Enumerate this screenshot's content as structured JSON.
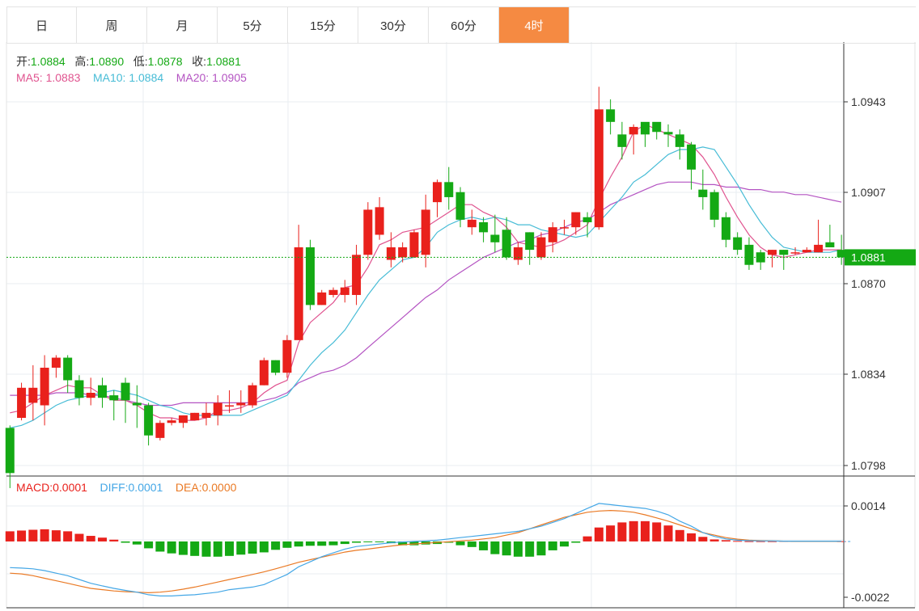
{
  "tabs": [
    {
      "label": "日",
      "active": false
    },
    {
      "label": "周",
      "active": false
    },
    {
      "label": "月",
      "active": false
    },
    {
      "label": "5分",
      "active": false
    },
    {
      "label": "15分",
      "active": false
    },
    {
      "label": "30分",
      "active": false
    },
    {
      "label": "60分",
      "active": false
    },
    {
      "label": "4时",
      "active": true
    }
  ],
  "colors": {
    "accent": "#f58a42",
    "up": "#e9211c",
    "down": "#14a914",
    "ma5": "#e0538f",
    "ma10": "#47bcd6",
    "ma20": "#b453c2",
    "diff": "#44a7e6",
    "dea": "#ea7a25",
    "legend_value": "#14a914",
    "grid": "#e8eef2"
  },
  "ohlc_legend": {
    "open_label": "开:",
    "open_value": "1.0884",
    "high_label": "高:",
    "high_value": "1.0890",
    "low_label": "低:",
    "low_value": "1.0878",
    "close_label": "收:",
    "close_value": "1.0881"
  },
  "ma_legend": {
    "ma5_label": "MA5:",
    "ma5_value": "1.0883",
    "ma10_label": "MA10:",
    "ma10_value": "1.0884",
    "ma20_label": "MA20:",
    "ma20_value": "1.0905"
  },
  "macd_legend": {
    "macd_label": "MACD:",
    "macd_value": "0.0001",
    "diff_label": "DIFF:",
    "diff_value": "0.0001",
    "dea_label": "DEA:",
    "dea_value": "0.0000"
  },
  "chart_data": [
    {
      "type": "candlestick",
      "yticks": [
        "1.0943",
        "1.0907",
        "1.0870",
        "1.0834",
        "1.0798"
      ],
      "ylim": [
        1.0791,
        1.0969
      ],
      "current_price": "1.0881",
      "candles": [
        [
          1.0813,
          1.0795,
          1.0814,
          1.0789
        ],
        [
          1.0817,
          1.0829,
          1.0831,
          1.0816
        ],
        [
          1.0823,
          1.0829,
          1.0838,
          1.0816
        ],
        [
          1.0822,
          1.0837,
          1.0842,
          1.0814
        ],
        [
          1.0837,
          1.0841,
          1.0842,
          1.0833
        ],
        [
          1.0841,
          1.0832,
          1.0842,
          1.0827
        ],
        [
          1.0832,
          1.0825,
          1.0834,
          1.0822
        ],
        [
          1.0825,
          1.0827,
          1.0833,
          1.0822
        ],
        [
          1.083,
          1.0825,
          1.0833,
          1.0821
        ],
        [
          1.0826,
          1.0824,
          1.0828,
          1.0816
        ],
        [
          1.0831,
          1.0824,
          1.0833,
          1.0815
        ],
        [
          1.0823,
          1.0822,
          1.083,
          1.0813
        ],
        [
          1.0822,
          1.081,
          1.0823,
          1.0806
        ],
        [
          1.0809,
          1.0815,
          1.0816,
          1.0808
        ],
        [
          1.0815,
          1.0816,
          1.0817,
          1.0814
        ],
        [
          1.0815,
          1.0818,
          1.0818,
          1.0813
        ],
        [
          1.0816,
          1.0819,
          1.0819,
          1.0816
        ],
        [
          1.0817,
          1.0819,
          1.0823,
          1.0814
        ],
        [
          1.0818,
          1.0823,
          1.0826,
          1.0814
        ],
        [
          1.0822,
          1.0822,
          1.0828,
          1.0819
        ],
        [
          1.0822,
          1.0823,
          1.0828,
          1.0819
        ],
        [
          1.0822,
          1.083,
          1.0831,
          1.0821
        ],
        [
          1.083,
          1.084,
          1.0841,
          1.083
        ],
        [
          1.084,
          1.0835,
          1.084,
          1.0834
        ],
        [
          1.0835,
          1.0848,
          1.085,
          1.0833
        ],
        [
          1.0848,
          1.0885,
          1.0894,
          1.0848
        ],
        [
          1.0885,
          1.0862,
          1.0888,
          1.086
        ],
        [
          1.0862,
          1.0867,
          1.0868,
          1.0862
        ],
        [
          1.0866,
          1.0868,
          1.0869,
          1.0865
        ],
        [
          1.0866,
          1.0869,
          1.0872,
          1.0863
        ],
        [
          1.0866,
          1.0882,
          1.0886,
          1.0862
        ],
        [
          1.0882,
          1.09,
          1.0903,
          1.088
        ],
        [
          1.089,
          1.0901,
          1.0905,
          1.0888
        ],
        [
          1.088,
          1.0885,
          1.0891,
          1.0877
        ],
        [
          1.0881,
          1.0885,
          1.0887,
          1.0879
        ],
        [
          1.0881,
          1.0891,
          1.0892,
          1.0881
        ],
        [
          1.0882,
          1.09,
          1.0906,
          1.0877
        ],
        [
          1.0903,
          1.0911,
          1.0912,
          1.0897
        ],
        [
          1.0911,
          1.0905,
          1.0917,
          1.09
        ],
        [
          1.0907,
          1.0896,
          1.0909,
          1.0893
        ],
        [
          1.0893,
          1.0896,
          1.09,
          1.089
        ],
        [
          1.0895,
          1.0891,
          1.0897,
          1.0887
        ],
        [
          1.089,
          1.0887,
          1.0898,
          1.0883
        ],
        [
          1.0892,
          1.0881,
          1.0897,
          1.088
        ],
        [
          1.088,
          1.0885,
          1.0887,
          1.0878
        ],
        [
          1.0891,
          1.0884,
          1.0891,
          1.0878
        ],
        [
          1.0881,
          1.0889,
          1.0891,
          1.088
        ],
        [
          1.0887,
          1.0893,
          1.0895,
          1.0883
        ],
        [
          1.0893,
          1.0893,
          1.0896,
          1.089
        ],
        [
          1.0893,
          1.0899,
          1.0899,
          1.089
        ],
        [
          1.0897,
          1.0895,
          1.0899,
          1.0889
        ],
        [
          1.0893,
          1.094,
          1.0949,
          1.0892
        ],
        [
          1.094,
          1.0935,
          1.0944,
          1.093
        ],
        [
          1.093,
          1.0925,
          1.0935,
          1.092
        ],
        [
          1.093,
          1.0933,
          1.0934,
          1.0922
        ],
        [
          1.0935,
          1.093,
          1.0932,
          1.0925
        ],
        [
          1.0935,
          1.0931,
          1.0934,
          1.0928
        ],
        [
          1.0931,
          1.093,
          1.0934,
          1.0925
        ],
        [
          1.093,
          1.0925,
          1.0932,
          1.092
        ],
        [
          1.0926,
          1.0916,
          1.0927,
          1.0908
        ],
        [
          1.0908,
          1.0905,
          1.0916,
          1.09
        ],
        [
          1.0907,
          1.0896,
          1.0908,
          1.0893
        ],
        [
          1.0897,
          1.0888,
          1.0899,
          1.0885
        ],
        [
          1.0889,
          1.0884,
          1.0891,
          1.0882
        ],
        [
          1.0886,
          1.0878,
          1.0889,
          1.0876
        ],
        [
          1.0883,
          1.0879,
          1.0884,
          1.0876
        ],
        [
          1.0882,
          1.0884,
          1.0884,
          1.0877
        ],
        [
          1.0884,
          1.0882,
          1.0884,
          1.0876
        ],
        [
          1.0883,
          1.0883,
          1.0885,
          1.0882
        ],
        [
          1.0883,
          1.0884,
          1.0885,
          1.0883
        ],
        [
          1.0883,
          1.0886,
          1.0896,
          1.0883
        ],
        [
          1.0887,
          1.0885,
          1.0894,
          1.0885
        ],
        [
          1.0884,
          1.0881,
          1.089,
          1.0878
        ]
      ],
      "ma5": [
        1.0819,
        1.082,
        1.0823,
        1.0826,
        1.0828,
        1.083,
        1.0829,
        1.0829,
        1.0826,
        1.0824,
        1.0824,
        1.0822,
        1.0819,
        1.0817,
        1.0817,
        1.0816,
        1.0816,
        1.0817,
        1.082,
        1.082,
        1.0821,
        1.0823,
        1.0827,
        1.083,
        1.0832,
        1.0847,
        1.0855,
        1.0859,
        1.0863,
        1.0869,
        1.087,
        1.0877,
        1.0886,
        1.0888,
        1.0891,
        1.0892,
        1.0893,
        1.0896,
        1.0899,
        1.0902,
        1.0902,
        1.0899,
        1.0897,
        1.0893,
        1.0887,
        1.0886,
        1.0885,
        1.0886,
        1.0888,
        1.0891,
        1.0894,
        1.0904,
        1.0913,
        1.0921,
        1.0931,
        1.0934,
        1.0932,
        1.093,
        1.0928,
        1.0926,
        1.0921,
        1.0914,
        1.0905,
        1.0897,
        1.089,
        1.0885,
        1.0882,
        1.0881,
        1.0882,
        1.0883,
        1.0884,
        1.0884,
        1.0884
      ],
      "ma10": [
        1.0813,
        1.0814,
        1.0816,
        1.0819,
        1.0822,
        1.0824,
        1.0825,
        1.0826,
        1.0827,
        1.0828,
        1.0827,
        1.0826,
        1.0824,
        1.0822,
        1.0821,
        1.0819,
        1.0818,
        1.0818,
        1.0818,
        1.0818,
        1.0818,
        1.082,
        1.0822,
        1.0824,
        1.0826,
        1.0832,
        1.0838,
        1.0843,
        1.0847,
        1.0852,
        1.0859,
        1.0866,
        1.0872,
        1.0876,
        1.088,
        1.0881,
        1.0885,
        1.0891,
        1.0894,
        1.0896,
        1.0897,
        1.0896,
        1.0897,
        1.0896,
        1.0894,
        1.0894,
        1.0892,
        1.0891,
        1.089,
        1.0889,
        1.089,
        1.0895,
        1.09,
        1.0905,
        1.0911,
        1.0914,
        1.0918,
        1.0922,
        1.0924,
        1.0924,
        1.0925,
        1.0924,
        1.0917,
        1.091,
        1.0902,
        1.0895,
        1.0889,
        1.0885,
        1.0884,
        1.0883,
        1.0883,
        1.0883,
        1.0884
      ],
      "ma20": [
        1.0826,
        1.0826,
        1.0826,
        1.0826,
        1.0827,
        1.0827,
        1.0827,
        1.0826,
        1.0826,
        1.0825,
        1.0824,
        1.0823,
        1.0822,
        1.0822,
        1.0822,
        1.0823,
        1.0823,
        1.0823,
        1.0823,
        1.0823,
        1.0823,
        1.0823,
        1.0824,
        1.0825,
        1.0827,
        1.0831,
        1.0833,
        1.0835,
        1.0836,
        1.0838,
        1.0841,
        1.0845,
        1.0849,
        1.0853,
        1.0857,
        1.0861,
        1.0865,
        1.0868,
        1.0872,
        1.0875,
        1.0878,
        1.0881,
        1.0883,
        1.0885,
        1.0887,
        1.0888,
        1.089,
        1.0891,
        1.0893,
        1.0895,
        1.0896,
        1.0899,
        1.0902,
        1.0904,
        1.0906,
        1.0908,
        1.091,
        1.0911,
        1.0911,
        1.0911,
        1.091,
        1.091,
        1.0909,
        1.0909,
        1.0908,
        1.0908,
        1.0907,
        1.0907,
        1.0906,
        1.0906,
        1.0905,
        1.0904,
        1.0903
      ]
    },
    {
      "type": "macd",
      "yticks": [
        "0.0014",
        "-0.0022"
      ],
      "ylim": [
        -0.0025,
        0.0018
      ],
      "macd": [
        0.0004,
        0.00043,
        0.00046,
        0.00048,
        0.00044,
        0.0004,
        0.0003,
        0.00022,
        0.00015,
        7e-05,
        -5e-05,
        -0.00012,
        -0.00027,
        -0.0004,
        -0.00047,
        -0.00053,
        -0.00057,
        -0.0006,
        -0.0006,
        -0.00057,
        -0.00052,
        -0.00048,
        -0.00043,
        -0.00033,
        -0.00025,
        -0.0002,
        -0.00017,
        -0.00017,
        -0.00015,
        -0.0001,
        -5e-05,
        -3e-05,
        -2e-05,
        -7e-05,
        -0.00015,
        -0.00015,
        -0.00012,
        -0.0001,
        -5e-05,
        -0.00015,
        -0.00022,
        -0.00035,
        -0.0005,
        -0.00055,
        -0.0006,
        -0.0006,
        -0.00055,
        -0.00035,
        -0.0002,
        -5e-05,
        0.0002,
        0.00055,
        0.00063,
        0.00075,
        0.0008,
        0.0008,
        0.00075,
        0.00063,
        0.00045,
        0.00032,
        0.00018,
        8e-05,
        5e-05,
        2e-05,
        1e-05,
        1e-05,
        1e-05,
        2e-05,
        2e-05,
        3e-05,
        3e-05,
        2e-05,
        1e-05
      ],
      "diff": [
        -0.00103,
        -0.00105,
        -0.00108,
        -0.00115,
        -0.00125,
        -0.00135,
        -0.0015,
        -0.00165,
        -0.00175,
        -0.00185,
        -0.00193,
        -0.002,
        -0.0021,
        -0.00215,
        -0.00215,
        -0.00212,
        -0.0021,
        -0.00205,
        -0.002,
        -0.0019,
        -0.00185,
        -0.0018,
        -0.0017,
        -0.0015,
        -0.0013,
        -0.001,
        -0.0008,
        -0.0006,
        -0.00045,
        -0.0003,
        -0.0002,
        -0.00015,
        -0.0001,
        -5e-05,
        -2e-05,
        0.0,
        2e-05,
        5e-05,
        0.0001,
        0.00015,
        0.0002,
        0.00025,
        0.0003,
        0.00035,
        0.0004,
        0.0005,
        0.0006,
        0.00075,
        0.0009,
        0.0011,
        0.0013,
        0.0015,
        0.00145,
        0.0014,
        0.00135,
        0.0013,
        0.0012,
        0.00105,
        0.0008,
        0.0006,
        0.00035,
        0.0002,
        0.0001,
        5e-05,
        3e-05,
        2e-05,
        2e-05,
        1e-05,
        1e-05,
        1e-05,
        1e-05,
        1e-05,
        1e-05
      ],
      "dea": [
        -0.00125,
        -0.00128,
        -0.00135,
        -0.00145,
        -0.00155,
        -0.00165,
        -0.00175,
        -0.00185,
        -0.0019,
        -0.00195,
        -0.00198,
        -0.002,
        -0.00202,
        -0.002,
        -0.00195,
        -0.00188,
        -0.0018,
        -0.0017,
        -0.0016,
        -0.0015,
        -0.0014,
        -0.0013,
        -0.0012,
        -0.00108,
        -0.00095,
        -0.00082,
        -0.00072,
        -0.00062,
        -0.00052,
        -0.00042,
        -0.00035,
        -0.0003,
        -0.00024,
        -0.00018,
        -0.00013,
        -0.0001,
        -7e-05,
        -4e-05,
        -1e-05,
        2e-05,
        5e-05,
        0.0001,
        0.00015,
        0.00025,
        0.00035,
        0.0005,
        0.00065,
        0.0008,
        0.00095,
        0.00105,
        0.00115,
        0.0012,
        0.00122,
        0.0012,
        0.00115,
        0.00105,
        0.00093,
        0.0008,
        0.00065,
        0.0005,
        0.00035,
        0.00025,
        0.00015,
        9e-05,
        5e-05,
        3e-05,
        2e-05,
        1e-05,
        0.0,
        0.0,
        0.0,
        0.0,
        0.0
      ]
    }
  ]
}
